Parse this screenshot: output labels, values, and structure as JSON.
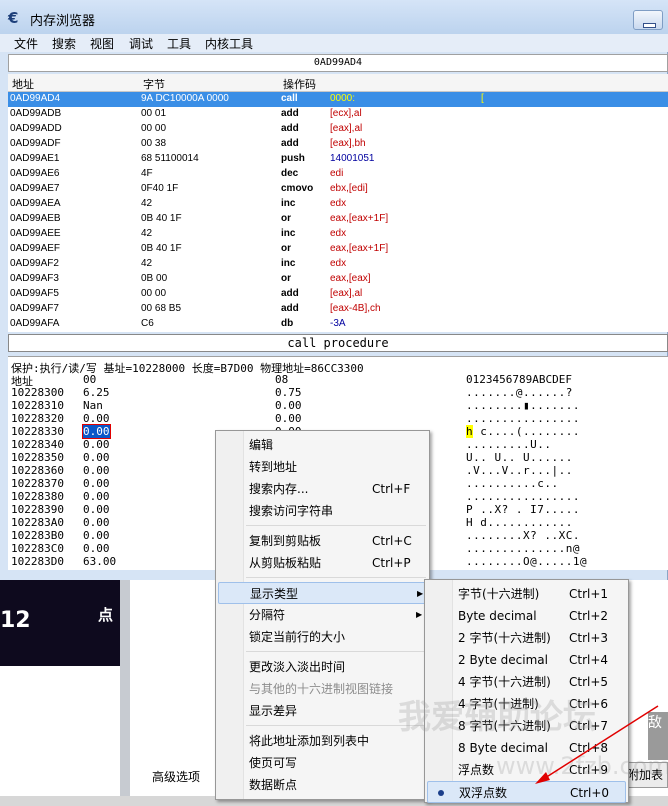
{
  "window": {
    "title": "内存浏览器",
    "min_glyph": ""
  },
  "menu": [
    "文件",
    "搜索",
    "视图",
    "调试",
    "工具",
    "内核工具"
  ],
  "address_bar": "0AD99AD4",
  "disasm_headers": {
    "address": "地址",
    "bytes": "字节",
    "opcode": "操作码"
  },
  "disasm_rows": [
    {
      "addr": "0AD99AD4",
      "bytes": "9A DC10000A 0000",
      "op": "call",
      "arg": "0000:",
      "cursor": "["
    },
    {
      "addr": "0AD99ADB",
      "bytes": "00 01",
      "op": "add",
      "arg": "[ecx],al"
    },
    {
      "addr": "0AD99ADD",
      "bytes": "00 00",
      "op": "add",
      "arg": "[eax],al"
    },
    {
      "addr": "0AD99ADF",
      "bytes": "00 38",
      "op": "add",
      "arg": "[eax],bh"
    },
    {
      "addr": "0AD99AE1",
      "bytes": "68 51100014",
      "op": "push",
      "arg": "14001051"
    },
    {
      "addr": "0AD99AE6",
      "bytes": "4F",
      "op": "dec",
      "arg": "edi"
    },
    {
      "addr": "0AD99AE7",
      "bytes": "0F40 1F",
      "op": "cmovo",
      "arg": "ebx,[edi]"
    },
    {
      "addr": "0AD99AEA",
      "bytes": "42",
      "op": "inc",
      "arg": "edx"
    },
    {
      "addr": "0AD99AEB",
      "bytes": "0B 40 1F",
      "op": "or",
      "arg": "eax,[eax+1F]"
    },
    {
      "addr": "0AD99AEE",
      "bytes": "42",
      "op": "inc",
      "arg": "edx"
    },
    {
      "addr": "0AD99AEF",
      "bytes": "0B 40 1F",
      "op": "or",
      "arg": "eax,[eax+1F]"
    },
    {
      "addr": "0AD99AF2",
      "bytes": "42",
      "op": "inc",
      "arg": "edx"
    },
    {
      "addr": "0AD99AF3",
      "bytes": "0B 00",
      "op": "or",
      "arg": "eax,[eax]"
    },
    {
      "addr": "0AD99AF5",
      "bytes": "00 00",
      "op": "add",
      "arg": "[eax],al"
    },
    {
      "addr": "0AD99AF7",
      "bytes": "00 68 B5",
      "op": "add",
      "arg": "[eax-4B],ch"
    },
    {
      "addr": "0AD99AFA",
      "bytes": "C6",
      "op": "db",
      "arg": "-3A"
    }
  ],
  "status_line": "call procedure",
  "hex": {
    "info": "保护:执行/读/写   基址=10228000 长度=B7D00 物理地址=86CC3300",
    "h_addr": "地址",
    "h_col0": "00",
    "h_col1": "08",
    "h_ascii": "0123456789ABCDEF",
    "rows": [
      {
        "addr": "10228300",
        "v0": "6.25",
        "v1": "0.75",
        "ascii": ".......@......?"
      },
      {
        "addr": "10228310",
        "v0": "Nan",
        "v1": "0.00",
        "ascii": "........▮......."
      },
      {
        "addr": "10228320",
        "v0": "0.00",
        "v1": "0.00",
        "ascii": "................"
      },
      {
        "addr": "10228330",
        "v0": "0.00",
        "v1": "0.00",
        "ascii_hl": "h",
        "ascii": " c....(........"
      },
      {
        "addr": "10228340",
        "v0": "0.00",
        "v1": "",
        "ascii": ".........U.."
      },
      {
        "addr": "10228350",
        "v0": "0.00",
        "v1": "",
        "ascii": " U.. U.. U......"
      },
      {
        "addr": "10228360",
        "v0": "0.00",
        "v1": "",
        "ascii": ".V...V..r...|.."
      },
      {
        "addr": "10228370",
        "v0": "0.00",
        "v1": "",
        "ascii": "..........c.."
      },
      {
        "addr": "10228380",
        "v0": "0.00",
        "v1": "",
        "ascii": "................"
      },
      {
        "addr": "10228390",
        "v0": "0.00",
        "v1": "",
        "ascii": "P ..X? . I7....."
      },
      {
        "addr": "102283A0",
        "v0": "0.00",
        "v1": "",
        "ascii": "H d............"
      },
      {
        "addr": "102283B0",
        "v0": "0.00",
        "v1": "",
        "ascii": "........X? ..XC."
      },
      {
        "addr": "102283C0",
        "v0": "0.00",
        "v1": "",
        "ascii": "..............n@"
      },
      {
        "addr": "102283D0",
        "v0": "63.00",
        "v1": "",
        "ascii": "........O@.....1@"
      }
    ]
  },
  "context_menu": [
    {
      "label": "编辑",
      "shortcut": ""
    },
    {
      "label": "转到地址",
      "shortcut": ""
    },
    {
      "label": "搜索内存...",
      "shortcut": "Ctrl+F"
    },
    {
      "label": "搜索访问字符串",
      "shortcut": ""
    },
    {
      "label": "复制到剪贴板",
      "shortcut": "Ctrl+C"
    },
    {
      "label": "从剪贴板粘贴",
      "shortcut": "Ctrl+P"
    },
    {
      "label": "显示类型",
      "shortcut": ""
    },
    {
      "label": "分隔符",
      "shortcut": ""
    },
    {
      "label": "锁定当前行的大小",
      "shortcut": ""
    },
    {
      "label": "更改淡入淡出时间",
      "shortcut": ""
    },
    {
      "label": "与其他的十六进制视图链接",
      "shortcut": ""
    },
    {
      "label": "显示差异",
      "shortcut": ""
    },
    {
      "label": "将此地址添加到列表中",
      "shortcut": ""
    },
    {
      "label": "使页可写",
      "shortcut": ""
    },
    {
      "label": "数据断点",
      "shortcut": ""
    }
  ],
  "submenu": [
    {
      "label": "字节(十六进制)",
      "shortcut": "Ctrl+1"
    },
    {
      "label": "Byte decimal",
      "shortcut": "Ctrl+2"
    },
    {
      "label": "2 字节(十六进制)",
      "shortcut": "Ctrl+3"
    },
    {
      "label": "2 Byte decimal",
      "shortcut": "Ctrl+4"
    },
    {
      "label": "4 字节(十六进制)",
      "shortcut": "Ctrl+5"
    },
    {
      "label": "4 字节(十进制)",
      "shortcut": "Ctrl+6"
    },
    {
      "label": "8 字节(十六进制)",
      "shortcut": "Ctrl+7"
    },
    {
      "label": "8 Byte decimal",
      "shortcut": "Ctrl+8"
    },
    {
      "label": "浮点数",
      "shortcut": "Ctrl+9"
    },
    {
      "label": "双浮点数",
      "shortcut": "Ctrl+0"
    }
  ],
  "background": {
    "big_number": "12",
    "side_char": "点",
    "advanced_options": "高级选项",
    "right_button": "附加表",
    "right_gray_char": "敌"
  },
  "watermark": {
    "line1": "我爱辅助论坛",
    "line2": "www.2fzb.com"
  },
  "colors": {
    "selection": "#3a8ee6",
    "arrow": "#e00000",
    "register": "#c00000",
    "number": "#00009f"
  }
}
